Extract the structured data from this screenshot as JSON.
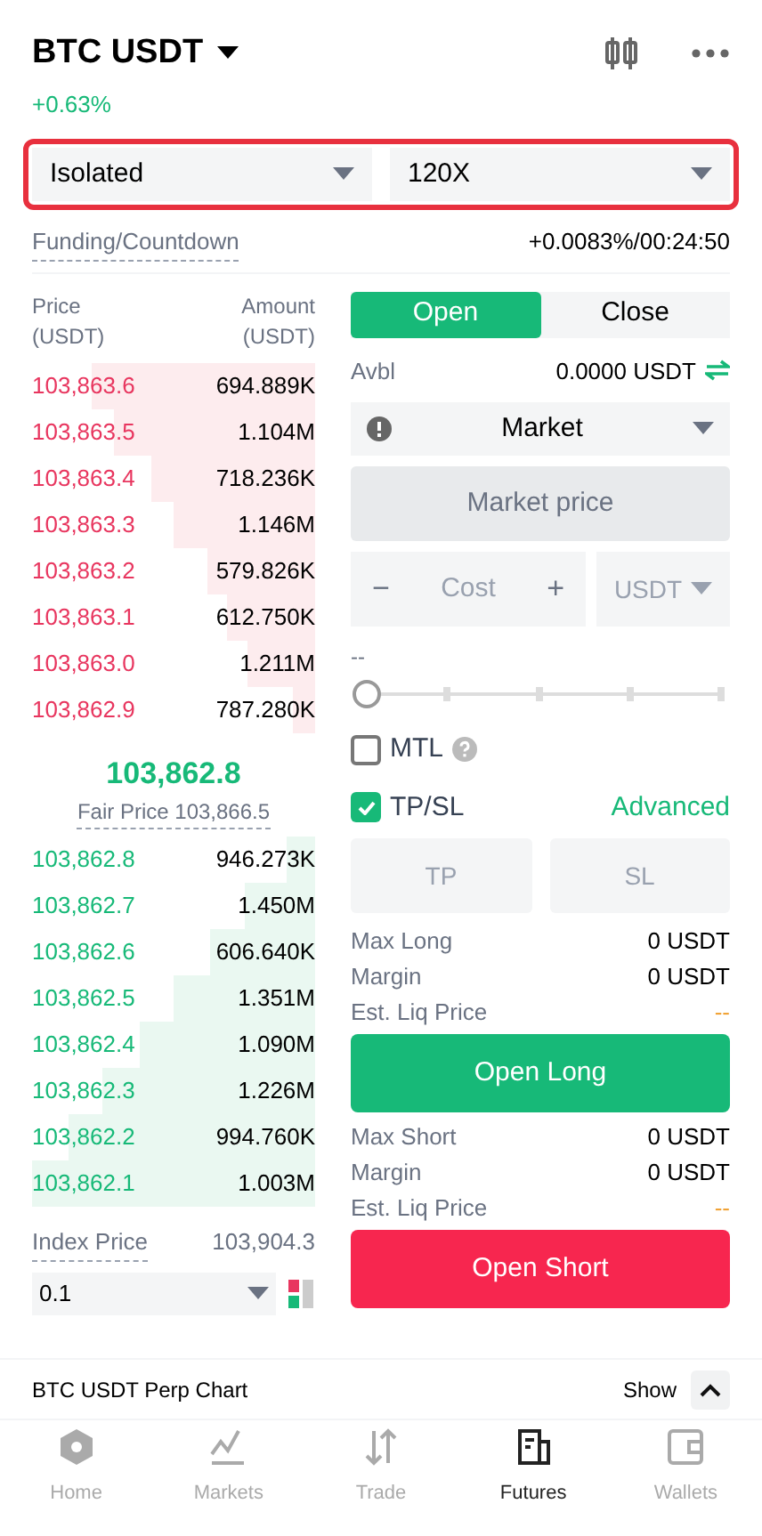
{
  "header": {
    "pair": "BTC USDT",
    "change": "+0.63%"
  },
  "margin_mode": {
    "value": "Isolated"
  },
  "leverage": {
    "value": "120X"
  },
  "funding": {
    "label": "Funding/Countdown",
    "value": "+0.0083%/00:24:50"
  },
  "order_book": {
    "price_header": "Price\n(USDT)",
    "amount_header": "Amount\n(USDT)",
    "asks": [
      {
        "price": "103,863.6",
        "amount": "694.889K"
      },
      {
        "price": "103,863.5",
        "amount": "1.104M"
      },
      {
        "price": "103,863.4",
        "amount": "718.236K"
      },
      {
        "price": "103,863.3",
        "amount": "1.146M"
      },
      {
        "price": "103,863.2",
        "amount": "579.826K"
      },
      {
        "price": "103,863.1",
        "amount": "612.750K"
      },
      {
        "price": "103,863.0",
        "amount": "1.211M"
      },
      {
        "price": "103,862.9",
        "amount": "787.280K"
      }
    ],
    "last_price": "103,862.8",
    "fair_price": "Fair Price 103,866.5",
    "bids": [
      {
        "price": "103,862.8",
        "amount": "946.273K"
      },
      {
        "price": "103,862.7",
        "amount": "1.450M"
      },
      {
        "price": "103,862.6",
        "amount": "606.640K"
      },
      {
        "price": "103,862.5",
        "amount": "1.351M"
      },
      {
        "price": "103,862.4",
        "amount": "1.090M"
      },
      {
        "price": "103,862.3",
        "amount": "1.226M"
      },
      {
        "price": "103,862.2",
        "amount": "994.760K"
      },
      {
        "price": "103,862.1",
        "amount": "1.003M"
      }
    ],
    "index_label": "Index Price",
    "index_value": "103,904.3",
    "precision": "0.1"
  },
  "order_form": {
    "tabs": [
      {
        "label": "Open",
        "selected": true
      },
      {
        "label": "Close",
        "selected": false
      }
    ],
    "avbl_label": "Avbl",
    "avbl_value": "0.0000 USDT",
    "order_type": "Market",
    "price_field": "Market price",
    "minus": "−",
    "cost_placeholder": "Cost",
    "plus": "+",
    "unit": "USDT",
    "slider_reading": "--",
    "slider": {
      "level": 0
    },
    "checks": [
      {
        "label": "MTL",
        "checked": false,
        "help": true
      },
      {
        "label": "TP/SL",
        "checked": true,
        "help": false
      }
    ],
    "advanced": "Advanced",
    "tp_placeholder": "TP",
    "sl_placeholder": "SL",
    "long_info": [
      {
        "label": "Max Long",
        "value": "0 USDT",
        "kind": "plain"
      },
      {
        "label": "Margin",
        "value": "0 USDT",
        "kind": "plain"
      },
      {
        "label": "Est. Liq Price",
        "value": "--",
        "kind": "warn"
      }
    ],
    "long_button": "Open Long",
    "short_info": [
      {
        "label": "Max Short",
        "value": "0 USDT",
        "kind": "plain"
      },
      {
        "label": "Margin",
        "value": "0 USDT",
        "kind": "plain"
      },
      {
        "label": "Est. Liq Price",
        "value": "--",
        "kind": "warn"
      }
    ],
    "short_button": "Open Short"
  },
  "chart_bar": {
    "title": "BTC USDT Perp Chart",
    "show": "Show"
  },
  "nav": [
    {
      "label": "Home",
      "kind": "home",
      "selected": false
    },
    {
      "label": "Markets",
      "kind": "markets",
      "selected": false
    },
    {
      "label": "Trade",
      "kind": "trade",
      "selected": false
    },
    {
      "label": "Futures",
      "kind": "futures",
      "selected": true
    },
    {
      "label": "Wallets",
      "kind": "wallets",
      "selected": false
    }
  ]
}
